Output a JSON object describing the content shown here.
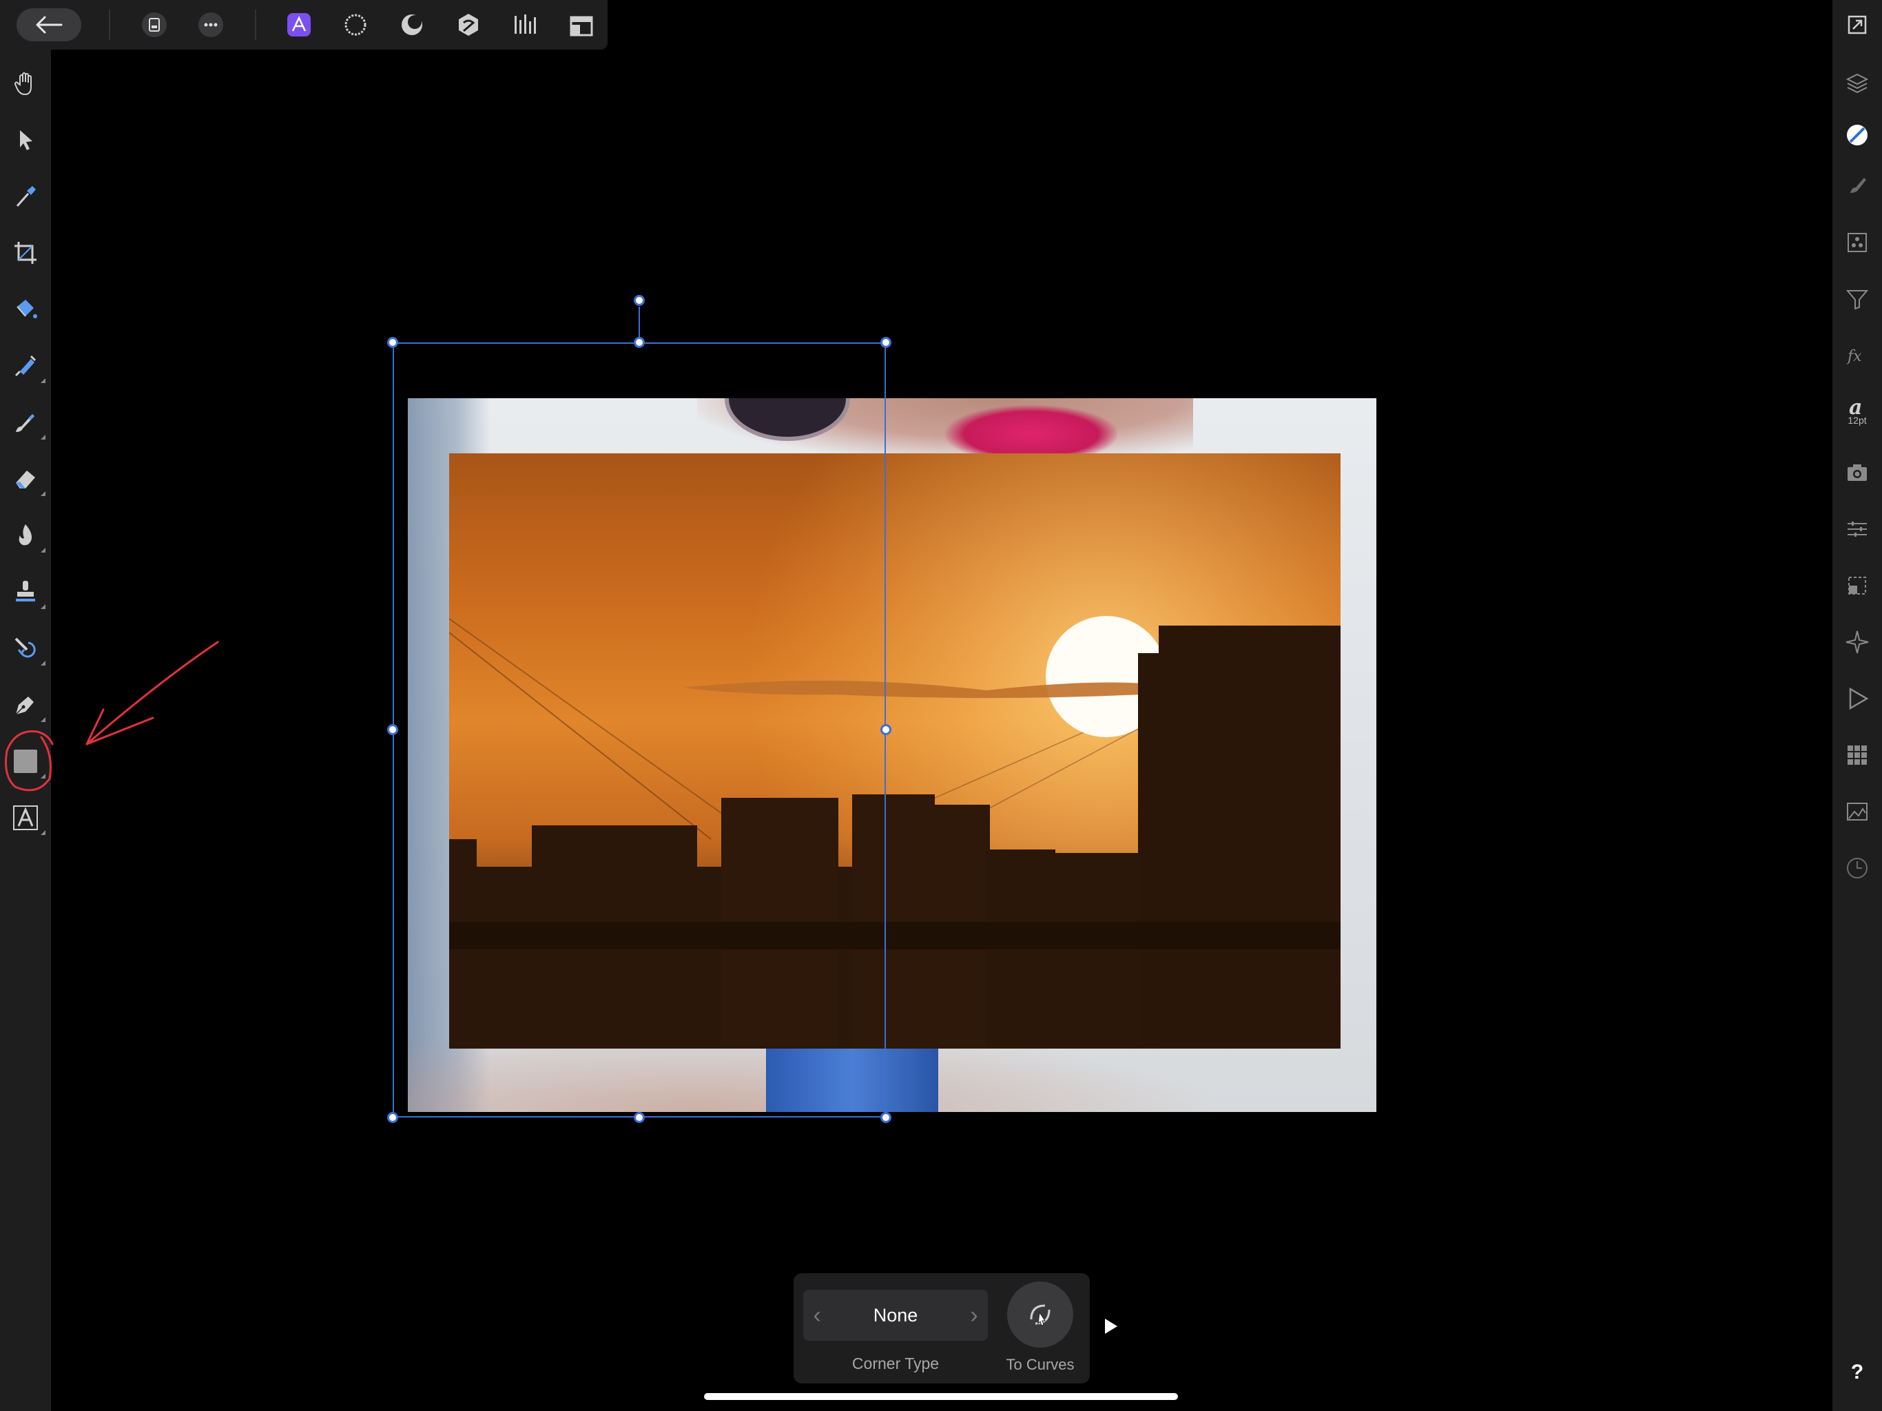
{
  "top_toolbar": {
    "icons": [
      "back-arrow-icon",
      "document-icon",
      "more-icon",
      "designer-persona-icon",
      "pixel-persona-icon",
      "tone-persona-icon",
      "liquify-persona-icon",
      "develop-persona-icon",
      "export-persona-icon"
    ],
    "accent": "#7b4ff0"
  },
  "left_toolbar": {
    "tools": [
      "hand-icon",
      "move-icon",
      "color-picker-icon",
      "crop-icon",
      "flood-fill-icon",
      "selection-brush-icon",
      "paint-brush-icon",
      "eraser-icon",
      "dodge-icon",
      "clone-icon",
      "healing-icon",
      "pen-icon",
      "rectangle-shape-icon",
      "text-icon"
    ]
  },
  "right_toolbar": {
    "font_size": "12pt"
  },
  "context_toolbar": {
    "corner_type_value": "None",
    "corner_type_label": "Corner Type",
    "to_curves_label": "To Curves"
  },
  "help_label": "?",
  "colors": {
    "selection": "#3b6fd6",
    "annotation": "#e0323c",
    "panel": "#1e1e1f"
  }
}
